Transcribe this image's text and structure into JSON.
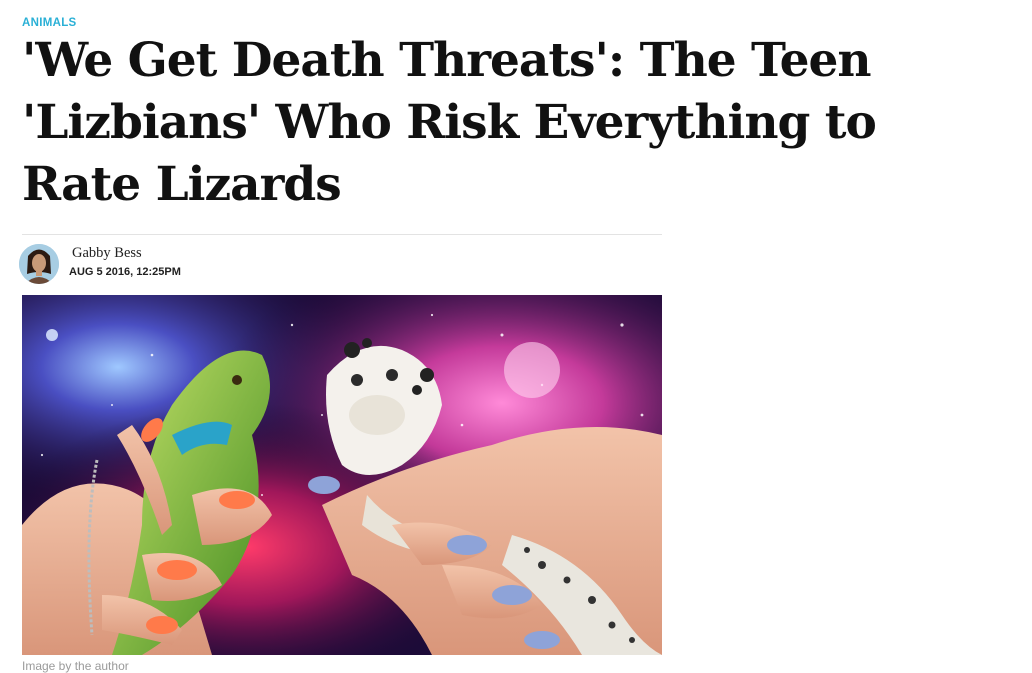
{
  "article": {
    "category": "ANIMALS",
    "headline": "'We Get Death Threats': The Teen 'Lizbians' Who Risk Everything to Rate Lizards",
    "author": {
      "name": "Gabby Bess",
      "avatar_icon": "author-avatar"
    },
    "published": "AUG 5 2016, 12:25PM",
    "image": {
      "description_icon": "hero-photo",
      "caption": "Image by the author"
    }
  },
  "colors": {
    "category": "#2ab0d6",
    "headline": "#111111",
    "caption": "#9a9a9a",
    "divider": "#e3e3e3"
  }
}
